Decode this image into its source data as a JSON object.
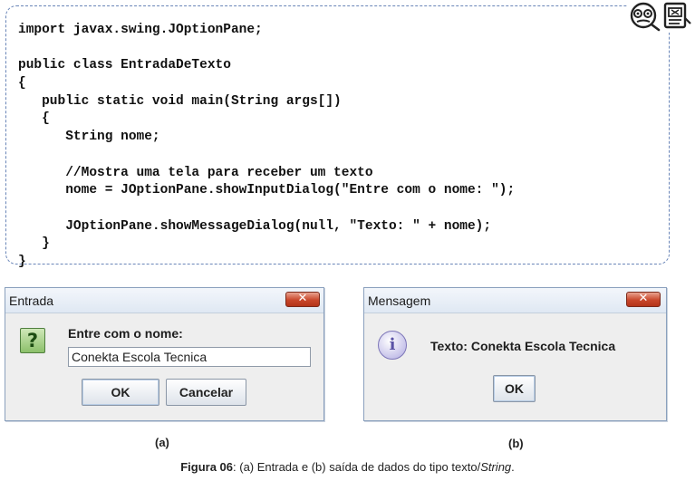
{
  "code": {
    "lines": [
      "import javax.swing.JOptionPane;",
      "",
      "public class EntradaDeTexto",
      "{",
      "   public static void main(String args[])",
      "   {",
      "      String nome;",
      "",
      "      //Mostra uma tela para receber um texto",
      "      nome = JOptionPane.showInputDialog(\"Entre com o nome: \");",
      "",
      "      JOptionPane.showMessageDialog(null, \"Texto: \" + nome);",
      "   }",
      "}"
    ]
  },
  "icons": {
    "corner": [
      "nerd-face-icon",
      "document-icon"
    ],
    "question": "question-icon",
    "question_glyph": "?",
    "info": "info-icon",
    "info_glyph": "i",
    "close_glyph": "✕"
  },
  "dialog_a": {
    "title": "Entrada",
    "prompt": "Entre com o nome:",
    "input_value": "Conekta Escola Tecnica",
    "ok_label": "OK",
    "cancel_label": "Cancelar",
    "caption": "(a)"
  },
  "dialog_b": {
    "title": "Mensagem",
    "message": "Texto: Conekta Escola Tecnica",
    "ok_label": "OK",
    "caption": "(b)"
  },
  "figure_caption": {
    "label": "Figura 06",
    "text_1": ": (a) Entrada e (b) saída de dados do tipo texto/",
    "text_italic": "String",
    "text_2": "."
  },
  "colors": {
    "code_border": "#6a86b8",
    "close_button": "#c9472b",
    "dialog_background": "#eeeeee"
  }
}
